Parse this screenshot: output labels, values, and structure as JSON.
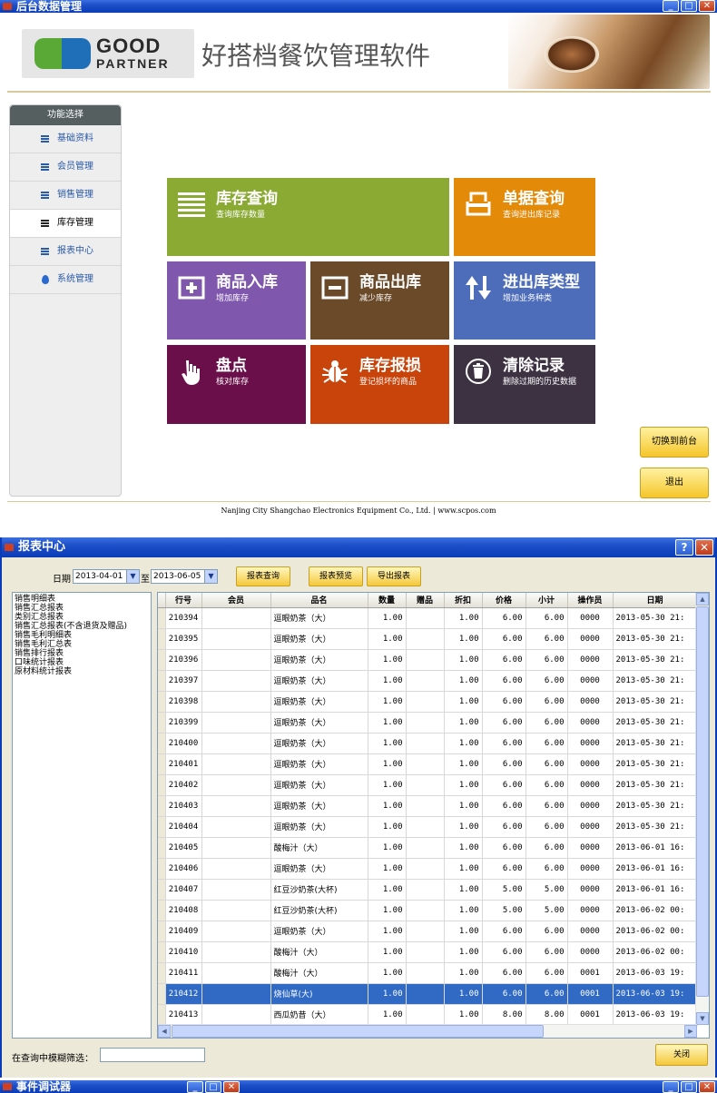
{
  "window1": {
    "title": "后台数据管理",
    "brand": {
      "logo_top": "GOOD",
      "logo_bottom": "PARTNER",
      "app_name": "好搭档餐饮管理软件"
    },
    "sidebar": {
      "header": "功能选择",
      "items": [
        {
          "label": "基础资料",
          "icon": "list-icon",
          "active": false
        },
        {
          "label": "会员管理",
          "icon": "list-icon",
          "active": false
        },
        {
          "label": "销售管理",
          "icon": "list-icon",
          "active": false
        },
        {
          "label": "库存管理",
          "icon": "list-icon",
          "active": true
        },
        {
          "label": "报表中心",
          "icon": "list-icon",
          "active": false
        },
        {
          "label": "系统管理",
          "icon": "drop-icon",
          "active": false
        }
      ]
    },
    "tiles": [
      {
        "title": "库存查询",
        "subtitle": "查询库存数量",
        "color": "#8aaa33",
        "icon": "list-icon"
      },
      {
        "title": "单据查询",
        "subtitle": "查询进出库记录",
        "color": "#e38a08",
        "icon": "document-icon"
      },
      {
        "title": "商品入库",
        "subtitle": "增加库存",
        "color": "#7f57ad",
        "icon": "plus-box-icon"
      },
      {
        "title": "商品出库",
        "subtitle": "减少库存",
        "color": "#6a4a28",
        "icon": "minus-box-icon"
      },
      {
        "title": "进出库类型",
        "subtitle": "增加业务种类",
        "color": "#4d6cb9",
        "icon": "swap-arrows-icon"
      },
      {
        "title": "盘点",
        "subtitle": "核对库存",
        "color": "#6a0f4a",
        "icon": "hand-icon"
      },
      {
        "title": "库存报损",
        "subtitle": "登记损坏的商品",
        "color": "#c8440a",
        "icon": "bug-icon"
      },
      {
        "title": "清除记录",
        "subtitle": "删除过期的历史数据",
        "color": "#3d3242",
        "icon": "trash-icon"
      }
    ],
    "buttons": {
      "switch_front": "切换到前台",
      "exit": "退出"
    },
    "footer": "Nanjing City Shangchao Electronics Equipment Co., Ltd. | www.scpos.com"
  },
  "window2": {
    "title": "报表中心",
    "date_label": "日期",
    "date_from": "2013-04-01",
    "date_to_label": "至",
    "date_to": "2013-06-05",
    "buttons": {
      "query": "报表查询",
      "preview": "报表预览",
      "export": "导出报表",
      "close": "关闭"
    },
    "report_list": [
      "销售明细表",
      "销售汇总报表",
      "类别汇总报表",
      "销售汇总报表(不含退货及赠品)",
      "销售毛利明细表",
      "销售毛利汇总表",
      "销售排行报表",
      "口味统计报表",
      "原材料统计报表"
    ],
    "columns": [
      "行号",
      "会员",
      "品名",
      "数量",
      "赠品",
      "折扣",
      "价格",
      "小计",
      "操作员",
      "日期"
    ],
    "rows": [
      [
        "210394",
        "",
        "逗眼奶茶（大）",
        "1.00",
        "",
        "1.00",
        "6.00",
        "6.00",
        "0000",
        "2013-05-30 21:"
      ],
      [
        "210395",
        "",
        "逗眼奶茶（大）",
        "1.00",
        "",
        "1.00",
        "6.00",
        "6.00",
        "0000",
        "2013-05-30 21:"
      ],
      [
        "210396",
        "",
        "逗眼奶茶（大）",
        "1.00",
        "",
        "1.00",
        "6.00",
        "6.00",
        "0000",
        "2013-05-30 21:"
      ],
      [
        "210397",
        "",
        "逗眼奶茶（大）",
        "1.00",
        "",
        "1.00",
        "6.00",
        "6.00",
        "0000",
        "2013-05-30 21:"
      ],
      [
        "210398",
        "",
        "逗眼奶茶（大）",
        "1.00",
        "",
        "1.00",
        "6.00",
        "6.00",
        "0000",
        "2013-05-30 21:"
      ],
      [
        "210399",
        "",
        "逗眼奶茶（大）",
        "1.00",
        "",
        "1.00",
        "6.00",
        "6.00",
        "0000",
        "2013-05-30 21:"
      ],
      [
        "210400",
        "",
        "逗眼奶茶（大）",
        "1.00",
        "",
        "1.00",
        "6.00",
        "6.00",
        "0000",
        "2013-05-30 21:"
      ],
      [
        "210401",
        "",
        "逗眼奶茶（大）",
        "1.00",
        "",
        "1.00",
        "6.00",
        "6.00",
        "0000",
        "2013-05-30 21:"
      ],
      [
        "210402",
        "",
        "逗眼奶茶（大）",
        "1.00",
        "",
        "1.00",
        "6.00",
        "6.00",
        "0000",
        "2013-05-30 21:"
      ],
      [
        "210403",
        "",
        "逗眼奶茶（大）",
        "1.00",
        "",
        "1.00",
        "6.00",
        "6.00",
        "0000",
        "2013-05-30 21:"
      ],
      [
        "210404",
        "",
        "逗眼奶茶（大）",
        "1.00",
        "",
        "1.00",
        "6.00",
        "6.00",
        "0000",
        "2013-05-30 21:"
      ],
      [
        "210405",
        "",
        "酸梅汁（大）",
        "1.00",
        "",
        "1.00",
        "6.00",
        "6.00",
        "0000",
        "2013-06-01 16:"
      ],
      [
        "210406",
        "",
        "逗眼奶茶（大）",
        "1.00",
        "",
        "1.00",
        "6.00",
        "6.00",
        "0000",
        "2013-06-01 16:"
      ],
      [
        "210407",
        "",
        "红豆沙奶茶(大杯)",
        "1.00",
        "",
        "1.00",
        "5.00",
        "5.00",
        "0000",
        "2013-06-01 16:"
      ],
      [
        "210408",
        "",
        "红豆沙奶茶(大杯)",
        "1.00",
        "",
        "1.00",
        "5.00",
        "5.00",
        "0000",
        "2013-06-02 00:"
      ],
      [
        "210409",
        "",
        "逗眼奶茶（大）",
        "1.00",
        "",
        "1.00",
        "6.00",
        "6.00",
        "0000",
        "2013-06-02 00:"
      ],
      [
        "210410",
        "",
        "酸梅汁（大）",
        "1.00",
        "",
        "1.00",
        "6.00",
        "6.00",
        "0000",
        "2013-06-02 00:"
      ],
      [
        "210411",
        "",
        "酸梅汁（大）",
        "1.00",
        "",
        "1.00",
        "6.00",
        "6.00",
        "0001",
        "2013-06-03 19:"
      ],
      [
        "210412",
        "",
        "烧仙草(大)",
        "1.00",
        "",
        "1.00",
        "6.00",
        "6.00",
        "0001",
        "2013-06-03 19:"
      ],
      [
        "210413",
        "",
        "西瓜奶昔（大）",
        "1.00",
        "",
        "1.00",
        "8.00",
        "8.00",
        "0001",
        "2013-06-03 19:"
      ]
    ],
    "selected_row": 18,
    "filter_label": "在查询中模糊筛选：",
    "filter_value": ""
  },
  "window3": {
    "title": "事件调试器"
  }
}
